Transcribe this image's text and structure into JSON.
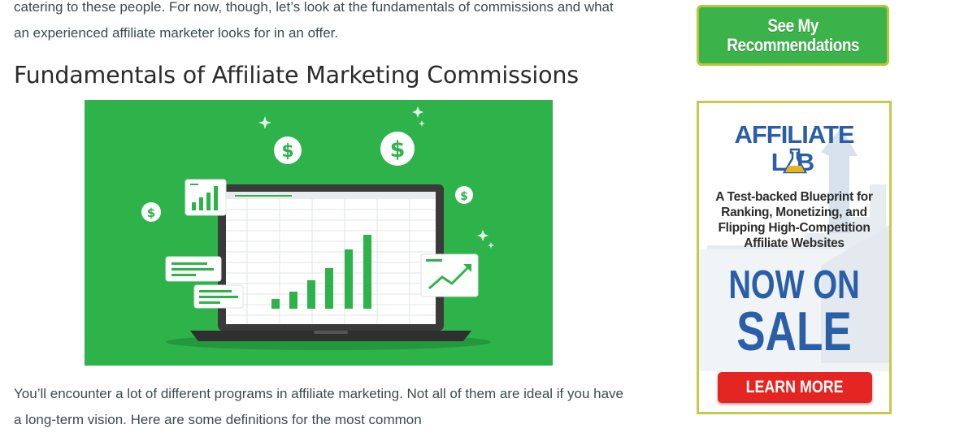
{
  "article": {
    "intro_paragraph": "catering to these people. For now, though, let’s look at the fundamentals of commissions and what an experienced affiliate marketer looks for in an offer.",
    "heading": "Fundamentals of Affiliate Marketing Commissions",
    "hero_image": {
      "background_color": "#2db34a",
      "bar_chart_bars": [
        1,
        1.6,
        2.4,
        3.4,
        4.9,
        5.8
      ],
      "icons": [
        "dollar-coin-icon",
        "laptop-spreadsheet-icon",
        "bar-chart-card-icon",
        "trend-arrow-card-icon",
        "chat-bubble-icon",
        "sparkle-icon"
      ]
    },
    "bottom_paragraph": "You’ll encounter a lot of different programs in affiliate marketing. Not all of them are ideal if you have a long-term vision. Here are some definitions for the most common"
  },
  "sidebar": {
    "recommend_button_label": "See My\nRecommendations",
    "recommend_button_color": "#3bb34a",
    "ad": {
      "logo_line1": "AFFILIATE",
      "logo_line2": "L B",
      "tagline": "A Test-backed Blueprint for Ranking, Monetizing, and Flipping High-Competition Affiliate Websites",
      "sale_line1": "NOW ON",
      "sale_line2": "SALE",
      "cta_label": "LEARN MORE",
      "brand_color": "#2a5fa8",
      "cta_color": "#e42521",
      "border_color": "#c4cb4a"
    }
  }
}
